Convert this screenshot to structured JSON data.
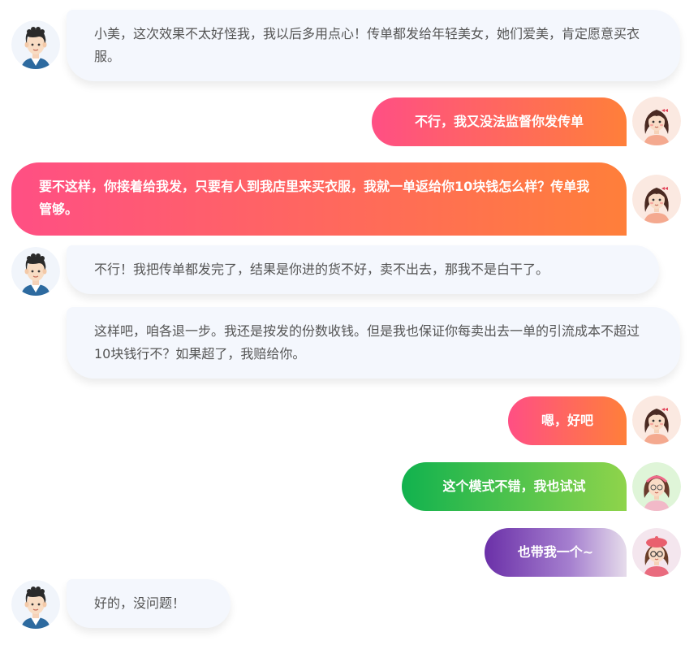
{
  "colors": {
    "grey_bubble": "#f4f7fd",
    "grey_text": "#555555",
    "pink_orange_start": "#ff4f84",
    "pink_orange_end": "#ff7f3a",
    "green_start": "#11b24e",
    "green_end": "#8fd44b",
    "purple_start": "#6b30a8",
    "purple_end": "#e6dceb"
  },
  "messages": [
    {
      "sender": "boy-avatar",
      "text": "小美，这次效果不太好怪我，我以后多用点心！传单都发给年轻美女，她们爱美，肯定愿意买衣服。"
    },
    {
      "sender": "girl-avatar",
      "text": "不行，我又没法监督你发传单"
    },
    {
      "sender": "girl-avatar",
      "text": "要不这样，你接着给我发，只要有人到我店里来买衣服，我就一单返给你10块钱怎么样？传单我管够。"
    },
    {
      "sender": "boy-avatar",
      "text": "不行！我把传单都发完了，结果是你进的货不好，卖不出去，那我不是白干了。"
    },
    {
      "sender": "boy-avatar",
      "text": "这样吧，咱各退一步。我还是按发的份数收钱。但是我也保证你每卖出去一单的引流成本不超过10块钱行不？如果超了，我赔给你。"
    },
    {
      "sender": "girl-avatar",
      "text": "嗯，好吧"
    },
    {
      "sender": "girl-headband-avatar",
      "text": "这个模式不错，我也试试"
    },
    {
      "sender": "girl-glasses-avatar",
      "text": "也带我一个~"
    },
    {
      "sender": "boy-avatar",
      "text": "好的，没问题！"
    }
  ]
}
